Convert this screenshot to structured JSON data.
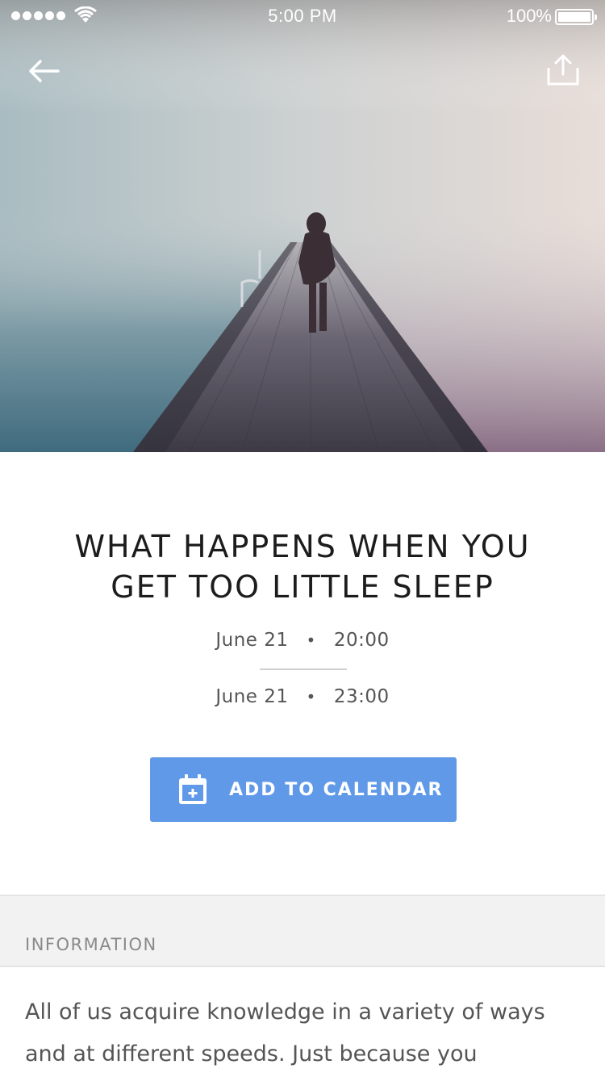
{
  "status_bar": {
    "time": "5:00 PM",
    "battery_percent": "100%",
    "signal_bars": 5
  },
  "hero": {
    "description_icons": {
      "back": "back-arrow-icon",
      "share": "share-icon"
    },
    "colors": {
      "fog_top": "#c9c4c4",
      "fog_left": "#7f9fa9",
      "pier": "#4a4654"
    }
  },
  "event": {
    "title": "WHAT HAPPENS WHEN YOU GET TOO LITTLE SLEEP",
    "start_date": "June 21",
    "start_time": "20:00",
    "end_date": "June 21",
    "end_time": "23:00",
    "separator": "•"
  },
  "actions": {
    "add_to_calendar": "ADD TO CALENDAR",
    "button_color": "#6099e8"
  },
  "information": {
    "section_label": "INFORMATION",
    "text": "All of us acquire knowledge in a variety of ways and at different speeds. Just because you"
  }
}
